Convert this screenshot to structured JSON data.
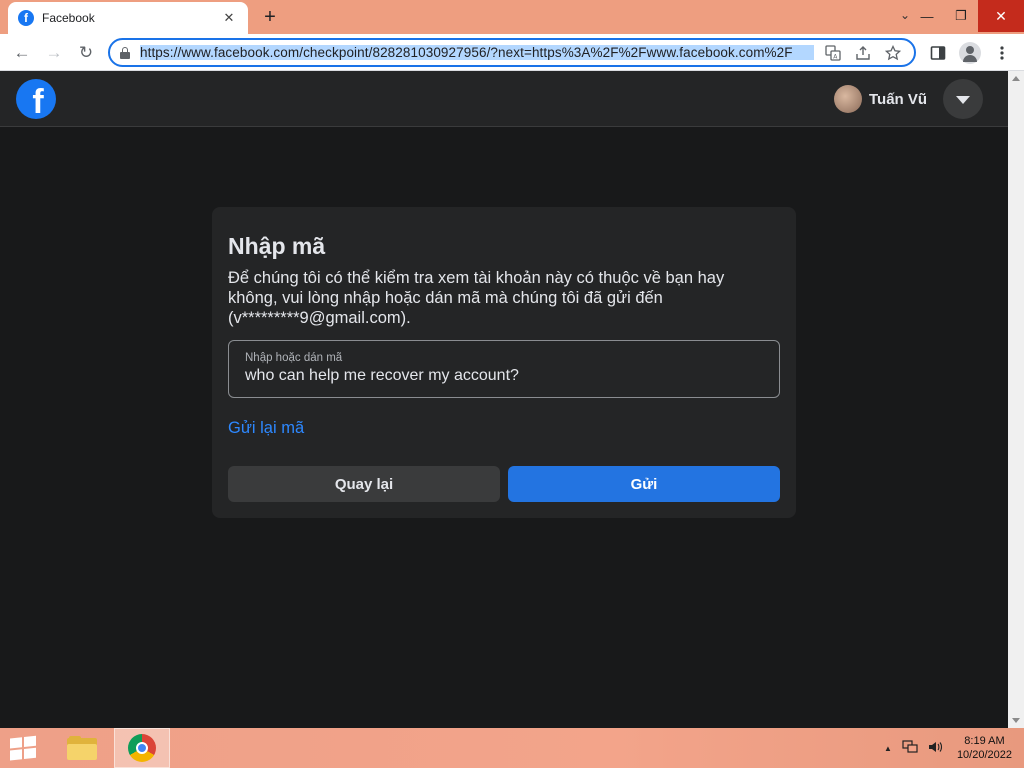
{
  "browser": {
    "tab_title": "Facebook",
    "tab_favicon_letter": "f",
    "tab_close": "✕",
    "new_tab": "+",
    "url": "https://www.facebook.com/checkpoint/828281030927956/?next=https%3A%2F%2Fwww.facebook.com%2F",
    "window_controls": {
      "dropdown": "⌄",
      "minimize": "—",
      "restore": "❐",
      "close": "✕"
    },
    "nav": {
      "back": "←",
      "forward": "→",
      "reload": "↻"
    },
    "omnibox_icons": [
      "translate-icon",
      "share-icon",
      "star-icon"
    ],
    "toolbar_icons": [
      "side-panel-icon",
      "profile-icon",
      "more-menu-icon"
    ]
  },
  "fb_header": {
    "logo_letter": "f",
    "user_name": "Tuấn Vũ"
  },
  "card": {
    "title": "Nhập mã",
    "description": "Để chúng tôi có thể kiểm tra xem tài khoản này có thuộc về bạn hay không, vui lòng nhập hoặc dán mã mà chúng tôi đã gửi đến (v*********9@gmail.com).",
    "code_field": {
      "label": "Nhập hoặc dán mã",
      "value": "who can help me recover my account?"
    },
    "resend_link": "Gửi lại mã",
    "back_button": "Quay lại",
    "send_button": "Gửi"
  },
  "taskbar": {
    "apps": [
      "file-explorer",
      "chrome"
    ],
    "active_app": "chrome",
    "tray": {
      "chevron": "▲"
    },
    "time": "8:19 AM",
    "date": "10/20/2022"
  },
  "colors": {
    "fb_blue": "#1877f2",
    "send_button": "#2374e1",
    "link": "#2d88ff",
    "page_bg": "#18191a",
    "card_bg": "#242526",
    "chrome_frame": "#ee9e80"
  }
}
